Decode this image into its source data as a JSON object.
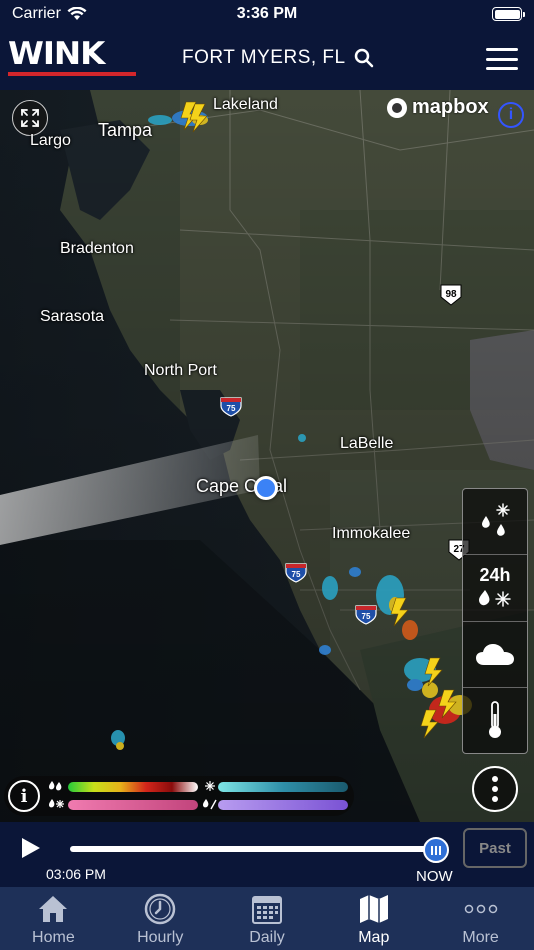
{
  "status_bar": {
    "carrier": "Carrier",
    "time": "3:36 PM"
  },
  "header": {
    "logo": "WINK",
    "location": "FORT MYERS, FL"
  },
  "map": {
    "attribution": "mapbox",
    "attribution_info": "i",
    "places": {
      "lakeland": "Lakeland",
      "tampa": "Tampa",
      "largo": "Largo",
      "bradenton": "Bradenton",
      "sarasota": "Sarasota",
      "north_port": "North Port",
      "labelle": "LaBelle",
      "cape_coral": "Cape Coral",
      "immokalee": "Immokalee"
    },
    "shields": {
      "us98": "98",
      "us27": "27",
      "i75_a": "75",
      "i75_b": "75",
      "i75_c": "75"
    }
  },
  "layers": {
    "duration_label": "24h"
  },
  "legend": {
    "info": "i",
    "rain_gradient": [
      "#25c93a",
      "#c8e01a",
      "#e6b31a",
      "#d4261b",
      "#8a0c0c",
      "#ffffff"
    ],
    "snow_gradient": [
      "#7ee6e6",
      "#2f8fa8",
      "#1a5a6e"
    ],
    "mix_gradient": [
      "#f07bb0",
      "#c2447c"
    ],
    "ice_gradient": [
      "#b89cf0",
      "#7a52d4"
    ]
  },
  "timeline": {
    "time": "03:06 PM",
    "now_label": "NOW",
    "past_label": "Past",
    "progress": 1.0
  },
  "tabs": [
    {
      "label": "Home",
      "icon": "home-icon",
      "active": false
    },
    {
      "label": "Hourly",
      "icon": "clock-icon",
      "active": false
    },
    {
      "label": "Daily",
      "icon": "calendar-icon",
      "active": false
    },
    {
      "label": "Map",
      "icon": "map-icon",
      "active": true
    },
    {
      "label": "More",
      "icon": "more-icon",
      "active": false
    }
  ]
}
